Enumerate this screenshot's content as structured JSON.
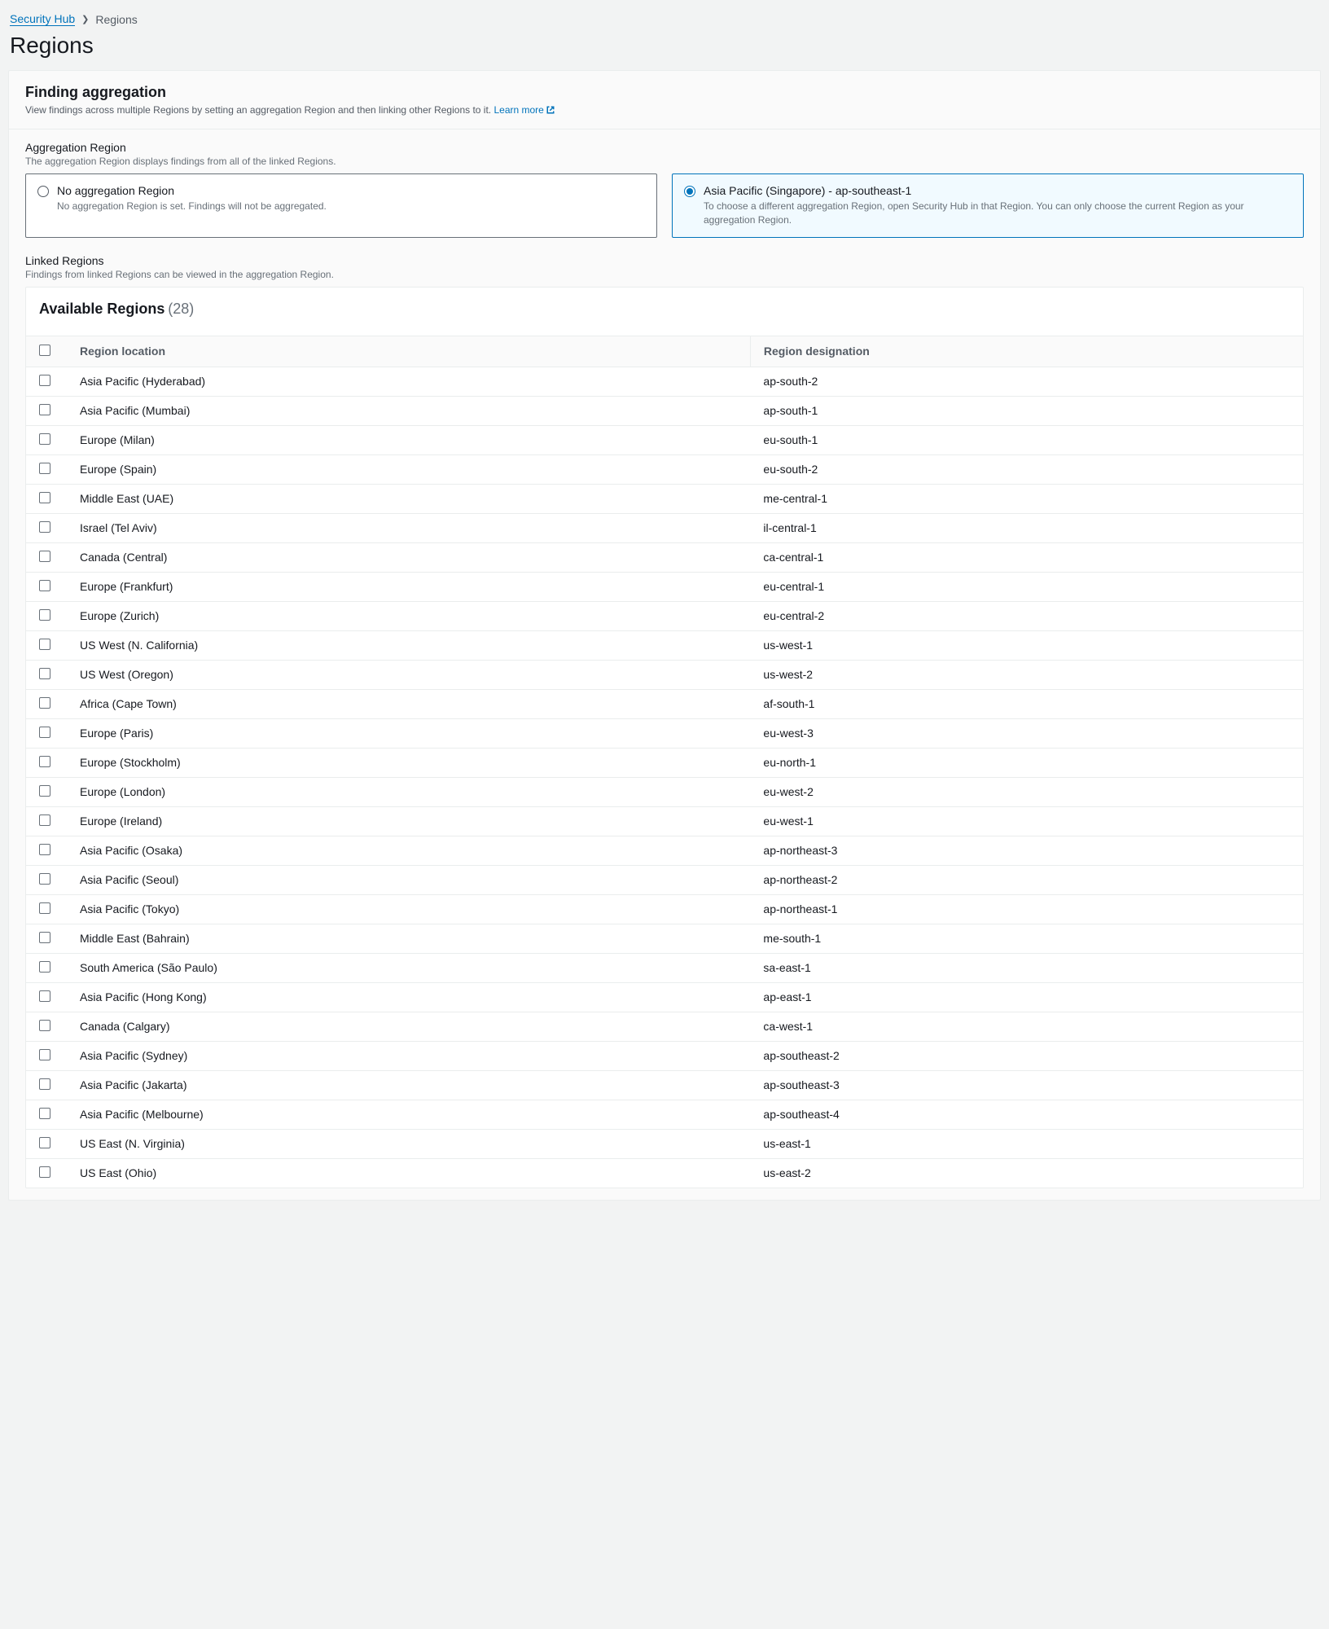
{
  "breadcrumb": {
    "root": "Security Hub",
    "current": "Regions"
  },
  "page_title": "Regions",
  "panel": {
    "title": "Finding aggregation",
    "desc_prefix": "View findings across multiple Regions by setting an aggregation Region and then linking other Regions to it. ",
    "learn_more": "Learn more"
  },
  "agg": {
    "label": "Aggregation Region",
    "sub": "The aggregation Region displays findings from all of the linked Regions.",
    "none": {
      "title": "No aggregation Region",
      "desc": "No aggregation Region is set. Findings will not be aggregated."
    },
    "sel": {
      "title": "Asia Pacific (Singapore) - ap-southeast-1",
      "desc": "To choose a different aggregation Region, open Security Hub in that Region. You can only choose the current Region as your aggregation Region."
    }
  },
  "linked": {
    "label": "Linked Regions",
    "sub": "Findings from linked Regions can be viewed in the aggregation Region."
  },
  "table": {
    "title": "Available Regions",
    "count": "(28)",
    "col_location": "Region location",
    "col_designation": "Region designation",
    "rows": [
      {
        "loc": "Asia Pacific (Hyderabad)",
        "des": "ap-south-2"
      },
      {
        "loc": "Asia Pacific (Mumbai)",
        "des": "ap-south-1"
      },
      {
        "loc": "Europe (Milan)",
        "des": "eu-south-1"
      },
      {
        "loc": "Europe (Spain)",
        "des": "eu-south-2"
      },
      {
        "loc": "Middle East (UAE)",
        "des": "me-central-1"
      },
      {
        "loc": "Israel (Tel Aviv)",
        "des": "il-central-1"
      },
      {
        "loc": "Canada (Central)",
        "des": "ca-central-1"
      },
      {
        "loc": "Europe (Frankfurt)",
        "des": "eu-central-1"
      },
      {
        "loc": "Europe (Zurich)",
        "des": "eu-central-2"
      },
      {
        "loc": "US West (N. California)",
        "des": "us-west-1"
      },
      {
        "loc": "US West (Oregon)",
        "des": "us-west-2"
      },
      {
        "loc": "Africa (Cape Town)",
        "des": "af-south-1"
      },
      {
        "loc": "Europe (Paris)",
        "des": "eu-west-3"
      },
      {
        "loc": "Europe (Stockholm)",
        "des": "eu-north-1"
      },
      {
        "loc": "Europe (London)",
        "des": "eu-west-2"
      },
      {
        "loc": "Europe (Ireland)",
        "des": "eu-west-1"
      },
      {
        "loc": "Asia Pacific (Osaka)",
        "des": "ap-northeast-3"
      },
      {
        "loc": "Asia Pacific (Seoul)",
        "des": "ap-northeast-2"
      },
      {
        "loc": "Asia Pacific (Tokyo)",
        "des": "ap-northeast-1"
      },
      {
        "loc": "Middle East (Bahrain)",
        "des": "me-south-1"
      },
      {
        "loc": "South America (São Paulo)",
        "des": "sa-east-1"
      },
      {
        "loc": "Asia Pacific (Hong Kong)",
        "des": "ap-east-1"
      },
      {
        "loc": "Canada (Calgary)",
        "des": "ca-west-1"
      },
      {
        "loc": "Asia Pacific (Sydney)",
        "des": "ap-southeast-2"
      },
      {
        "loc": "Asia Pacific (Jakarta)",
        "des": "ap-southeast-3"
      },
      {
        "loc": "Asia Pacific (Melbourne)",
        "des": "ap-southeast-4"
      },
      {
        "loc": "US East (N. Virginia)",
        "des": "us-east-1"
      },
      {
        "loc": "US East (Ohio)",
        "des": "us-east-2"
      }
    ]
  }
}
